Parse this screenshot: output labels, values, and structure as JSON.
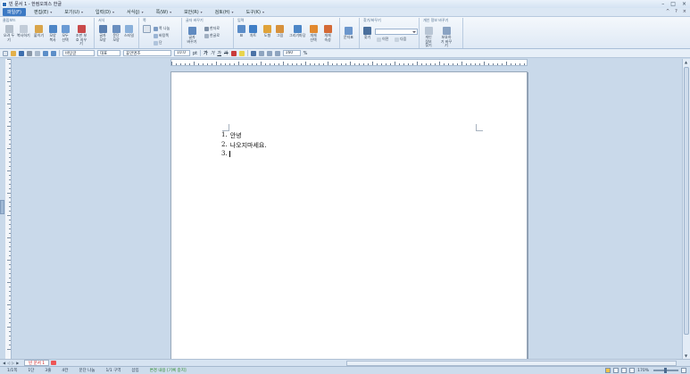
{
  "titlebar": {
    "title": "빈 문서 1 - 한컴오피스 한글",
    "controls": [
      "–",
      "□",
      "×"
    ]
  },
  "menubar": {
    "items": [
      {
        "label": "파일(F)",
        "active": true
      },
      {
        "label": "편집(E)"
      },
      {
        "label": "보기(U)"
      },
      {
        "label": "입력(D)"
      },
      {
        "label": "서식(J)"
      },
      {
        "label": "쪽(W)"
      },
      {
        "label": "보안(R)"
      },
      {
        "label": "검토(H)"
      },
      {
        "label": "도구(K)"
      }
    ],
    "right": [
      "^",
      "?",
      "×"
    ]
  },
  "ribbon": {
    "groups": [
      {
        "title": "클립보드"
      },
      {
        "title": "서식"
      },
      {
        "title": "쪽"
      },
      {
        "title": "글자 바꾸기"
      },
      {
        "title": "입력"
      },
      {
        "title": "찾기/바꾸기"
      },
      {
        "title": "개인 정보 바꾸기"
      }
    ],
    "buttons": {
      "cut": "오려 두기",
      "copy": "복사하기",
      "paste": "붙이기",
      "format_copy": "모양 복사",
      "select_all": "모두 선택",
      "protect": "조판 보호 지우기",
      "char_shape": "글자 모양",
      "para_shape": "문단 모양",
      "style": "스타일",
      "split_column": "쪽 나눔",
      "page_border": "바탕쪽",
      "columns": "단",
      "char_replace": "글자 바꾸기",
      "hanja": "한자로",
      "hangul": "한글로",
      "table": "표",
      "chart": "차트",
      "shapes": "도형",
      "picture": "그림",
      "draw_pen": "그리기마당",
      "equation": "개체 선택",
      "obj_props": "개체 속성",
      "symbols": "문자표",
      "find": "찾기",
      "prev": "이전",
      "next": "다음",
      "privacy_find": "개인 정보 찾기",
      "privacy_change": "보호하기 바꾸기"
    }
  },
  "formatbar": {
    "style": "바탕글",
    "lang": "대표",
    "font": "휴먼명조",
    "size": "10.0",
    "unit": "pt",
    "bold": "가",
    "italic": "가",
    "underline": "가",
    "strike": "가",
    "zoom": "160",
    "zoom_unit": "%"
  },
  "document": {
    "lines": [
      {
        "num": "1.",
        "text": "안녕"
      },
      {
        "num": "2.",
        "text": "나오지마세요."
      },
      {
        "num": "3.",
        "text": ""
      }
    ]
  },
  "tabs": {
    "doc_tab": "빈 문서 1"
  },
  "statusbar": {
    "page": "1/1쪽",
    "section": "1단",
    "line": "3줄",
    "col": "4칸",
    "paragraph": "문단 나눔",
    "zone": "1/1 구역",
    "insert": "삽입",
    "track": "변경 내용 [기록 중지]",
    "zoom": "170%"
  },
  "colors": {
    "accent": "#3d7ac4",
    "tab_text": "#c8171d",
    "track_status": "#2c8a2c"
  }
}
